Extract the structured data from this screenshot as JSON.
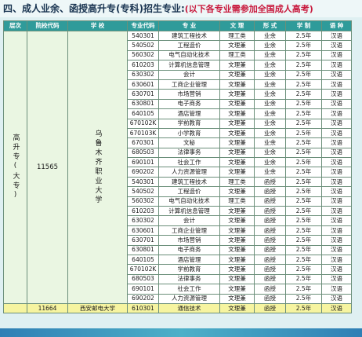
{
  "heading": {
    "main": "四、成人业余、函授高升专(专科)招生专业:",
    "note": "(以下各专业需参加全国成人高考)"
  },
  "columns": [
    "层次",
    "院校代码",
    "学 校",
    "专业代码",
    "专 业",
    "文 理",
    "形 式",
    "学 制",
    "语 种"
  ],
  "group": {
    "level": "高升专(大专)",
    "school_code": "11565",
    "school_name": "乌鲁木齐职业大学"
  },
  "rows": [
    {
      "code": "540301",
      "major": "建筑工程技术",
      "type": "理工类",
      "form": "业余",
      "years": "2.5年",
      "lang": "汉语"
    },
    {
      "code": "540502",
      "major": "工程造价",
      "type": "文理兼",
      "form": "业余",
      "years": "2.5年",
      "lang": "汉语"
    },
    {
      "code": "560302",
      "major": "电气自动化技术",
      "type": "理工类",
      "form": "业余",
      "years": "2.5年",
      "lang": "汉语"
    },
    {
      "code": "610203",
      "major": "计算机信息管理",
      "type": "文理兼",
      "form": "业余",
      "years": "2.5年",
      "lang": "汉语"
    },
    {
      "code": "630302",
      "major": "会计",
      "type": "文理兼",
      "form": "业余",
      "years": "2.5年",
      "lang": "汉语"
    },
    {
      "code": "630601",
      "major": "工商企业管理",
      "type": "文理兼",
      "form": "业余",
      "years": "2.5年",
      "lang": "汉语"
    },
    {
      "code": "630701",
      "major": "市场营销",
      "type": "文理兼",
      "form": "业余",
      "years": "2.5年",
      "lang": "汉语"
    },
    {
      "code": "630801",
      "major": "电子商务",
      "type": "文理兼",
      "form": "业余",
      "years": "2.5年",
      "lang": "汉语"
    },
    {
      "code": "640105",
      "major": "酒店管理",
      "type": "文理兼",
      "form": "业余",
      "years": "2.5年",
      "lang": "汉语"
    },
    {
      "code": "670102K",
      "major": "学前教育",
      "type": "文理兼",
      "form": "业余",
      "years": "2.5年",
      "lang": "汉语"
    },
    {
      "code": "670103K",
      "major": "小学教育",
      "type": "文理兼",
      "form": "业余",
      "years": "2.5年",
      "lang": "汉语"
    },
    {
      "code": "670301",
      "major": "文秘",
      "type": "文理兼",
      "form": "业余",
      "years": "2.5年",
      "lang": "汉语"
    },
    {
      "code": "680503",
      "major": "法律事务",
      "type": "文理兼",
      "form": "业余",
      "years": "2.5年",
      "lang": "汉语"
    },
    {
      "code": "690101",
      "major": "社会工作",
      "type": "文理兼",
      "form": "业余",
      "years": "2.5年",
      "lang": "汉语"
    },
    {
      "code": "690202",
      "major": "人力资源管理",
      "type": "文理兼",
      "form": "业余",
      "years": "2.5年",
      "lang": "汉语"
    },
    {
      "code": "540301",
      "major": "建筑工程技术",
      "type": "理工类",
      "form": "函授",
      "years": "2.5年",
      "lang": "汉语"
    },
    {
      "code": "540502",
      "major": "工程造价",
      "type": "文理兼",
      "form": "函授",
      "years": "2.5年",
      "lang": "汉语"
    },
    {
      "code": "560302",
      "major": "电气自动化技术",
      "type": "理工类",
      "form": "函授",
      "years": "2.5年",
      "lang": "汉语"
    },
    {
      "code": "610203",
      "major": "计算机信息管理",
      "type": "文理兼",
      "form": "函授",
      "years": "2.5年",
      "lang": "汉语"
    },
    {
      "code": "630302",
      "major": "会计",
      "type": "文理兼",
      "form": "函授",
      "years": "2.5年",
      "lang": "汉语"
    },
    {
      "code": "630601",
      "major": "工商企业管理",
      "type": "文理兼",
      "form": "函授",
      "years": "2.5年",
      "lang": "汉语"
    },
    {
      "code": "630701",
      "major": "市场营销",
      "type": "文理兼",
      "form": "函授",
      "years": "2.5年",
      "lang": "汉语"
    },
    {
      "code": "630801",
      "major": "电子商务",
      "type": "文理兼",
      "form": "函授",
      "years": "2.5年",
      "lang": "汉语"
    },
    {
      "code": "640105",
      "major": "酒店管理",
      "type": "文理兼",
      "form": "函授",
      "years": "2.5年",
      "lang": "汉语"
    },
    {
      "code": "670102K",
      "major": "学前教育",
      "type": "文理兼",
      "form": "函授",
      "years": "2.5年",
      "lang": "汉语"
    },
    {
      "code": "680503",
      "major": "法律事务",
      "type": "文理兼",
      "form": "函授",
      "years": "2.5年",
      "lang": "汉语"
    },
    {
      "code": "690101",
      "major": "社会工作",
      "type": "文理兼",
      "form": "函授",
      "years": "2.5年",
      "lang": "汉语"
    },
    {
      "code": "690202",
      "major": "人力资源管理",
      "type": "文理兼",
      "form": "函授",
      "years": "2.5年",
      "lang": "汉语"
    }
  ],
  "last_row": {
    "school_code": "11664",
    "school_name": "西安邮电大学",
    "code": "610301",
    "major": "通信技术",
    "type": "文理兼",
    "form": "函授",
    "years": "2.5年",
    "lang": "汉语"
  }
}
